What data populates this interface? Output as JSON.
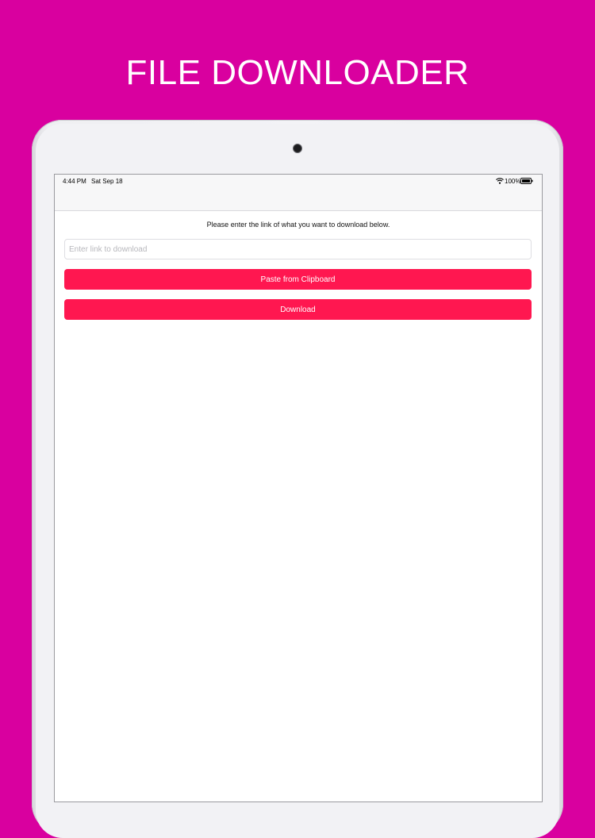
{
  "headline": "FILE DOWNLOADER",
  "status_bar": {
    "time": "4:44 PM",
    "date": "Sat Sep 18",
    "battery": "100%",
    "wifi_icon": "wifi-icon",
    "battery_icon": "battery-full-icon"
  },
  "main": {
    "instructions": "Please enter the link of what you want to download below.",
    "link_input": {
      "value": "",
      "placeholder": "Enter link to download"
    },
    "paste_button": "Paste from Clipboard",
    "download_button": "Download"
  },
  "colors": {
    "background": "#d9009f",
    "button": "#ff1750",
    "button_text": "#ffffff"
  }
}
